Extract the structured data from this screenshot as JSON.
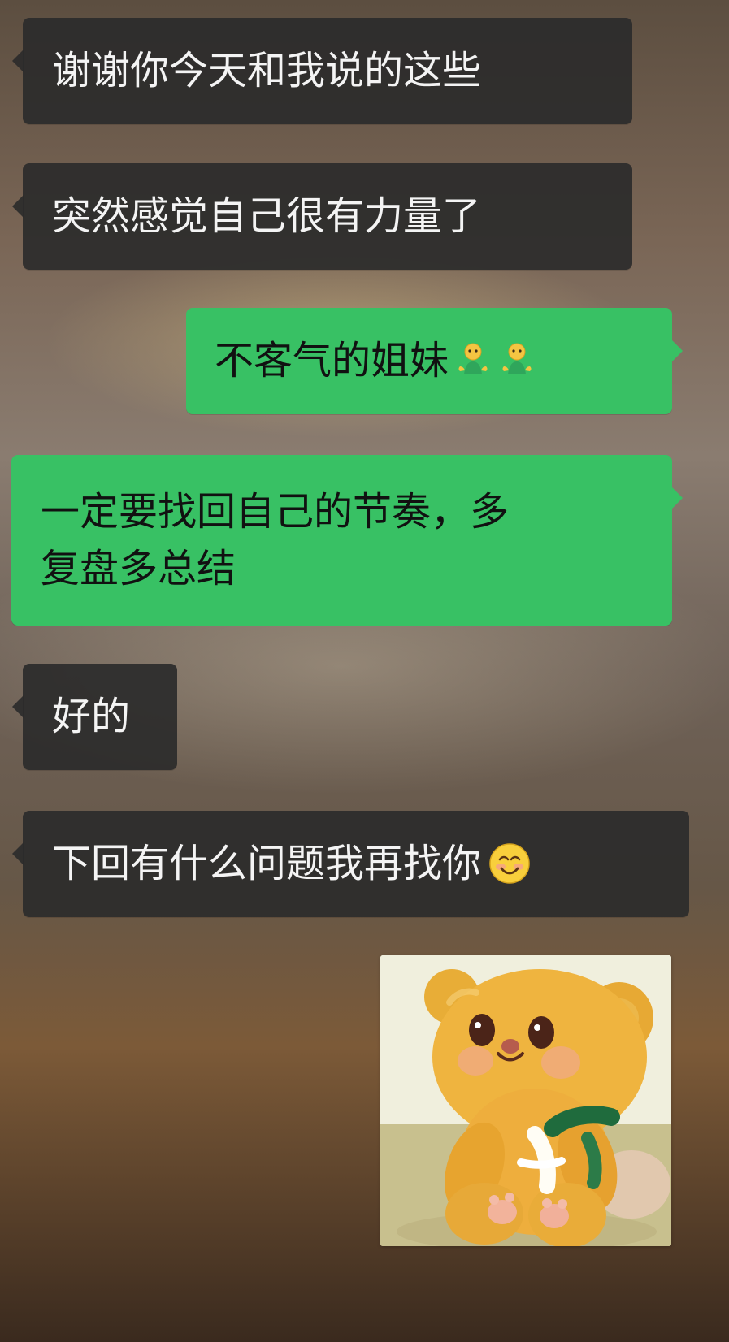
{
  "messages": [
    {
      "id": "m1",
      "direction": "incoming",
      "text": "谢谢你今天和我说的这些"
    },
    {
      "id": "m2",
      "direction": "incoming",
      "text": "突然感觉自己很有力量了"
    },
    {
      "id": "m3",
      "direction": "outgoing",
      "text": "不客气的姐妹",
      "emoji": [
        "hugging-person-icon",
        "hugging-person-icon"
      ]
    },
    {
      "id": "m4",
      "direction": "outgoing",
      "lines": [
        "一定要找回自己的节奏，多",
        "复盘多总结"
      ]
    },
    {
      "id": "m5",
      "direction": "incoming",
      "text": "好的"
    },
    {
      "id": "m6",
      "direction": "incoming",
      "text": "下回有什么问题我再找你",
      "emoji": [
        "smiling-face-icon"
      ]
    }
  ],
  "image_message": {
    "type": "sticker-image",
    "subject": "plush-bear"
  },
  "colors": {
    "incoming_bubble": "#2b2b2b",
    "outgoing_bubble": "#38c164",
    "incoming_text": "#f4f4f4",
    "outgoing_text": "#111111"
  }
}
